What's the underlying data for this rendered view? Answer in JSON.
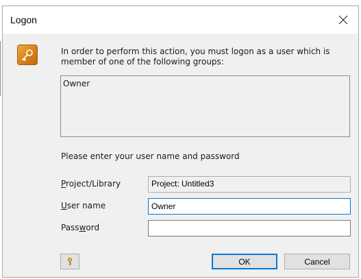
{
  "background": {
    "partial_text": "— — — —  · · ·"
  },
  "dialog": {
    "title": "Logon",
    "close_symbol": "✕",
    "icon": "key-icon",
    "message": "In order to perform this action, you must logon as a user which is\nmember of one of the following groups:",
    "groups": [
      "Owner"
    ],
    "prompt": "Please enter your user name and password",
    "fields": {
      "project": {
        "label_pre": "",
        "label_mnemonic": "P",
        "label_post": "roject/Library",
        "value": "Project: Untitled3"
      },
      "username": {
        "label_pre": "",
        "label_mnemonic": "U",
        "label_post": "ser name",
        "value": "Owner"
      },
      "password": {
        "label_pre": "Pass",
        "label_mnemonic": "w",
        "label_post": "ord",
        "value": ""
      }
    },
    "buttons": {
      "hint_icon": "key-icon",
      "ok": "OK",
      "cancel": "Cancel"
    }
  },
  "colors": {
    "accent": "#0078d7",
    "dialog_bg": "#f0f0f0",
    "key_orange": "#d67d1a"
  }
}
